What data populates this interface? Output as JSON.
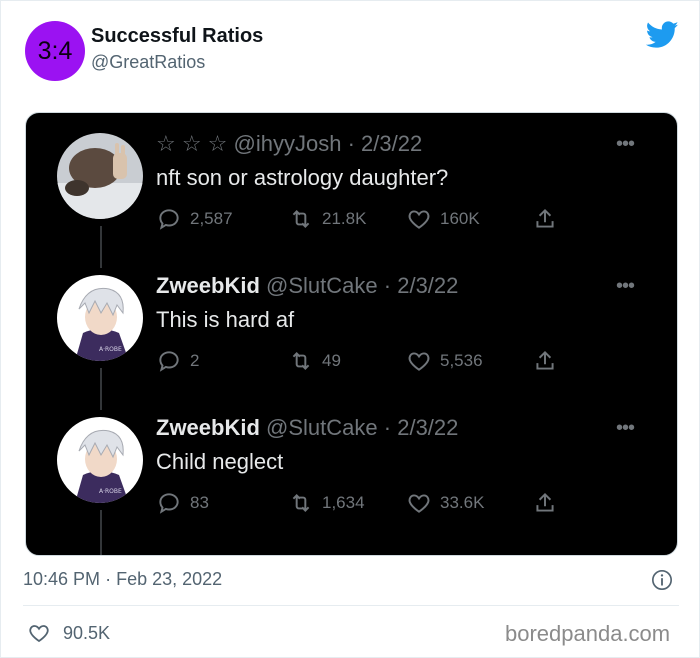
{
  "header": {
    "avatar_text": "3:4",
    "avatar_color": "#9b12f2",
    "name": "Successful Ratios",
    "handle": "@GreatRatios",
    "logo_icon": "twitter-bird-icon",
    "brand_color": "#1d9bf0"
  },
  "embedded_thread": {
    "tweets": [
      {
        "name": "",
        "stars": "☆ ☆ ☆",
        "handle": "@ihyyJosh",
        "date": "2/3/22",
        "text": "nft son or astrology daughter?",
        "replies": "2,587",
        "retweets": "21.8K",
        "likes": "160K"
      },
      {
        "name": "ZweebKid",
        "handle": "@SlutCake",
        "date": "2/3/22",
        "text": "This is hard af",
        "replies": "2",
        "retweets": "49",
        "likes": "5,536"
      },
      {
        "name": "ZweebKid",
        "handle": "@SlutCake",
        "date": "2/3/22",
        "text": "Child neglect",
        "replies": "83",
        "retweets": "1,634",
        "likes": "33.6K"
      }
    ],
    "more_glyph": "•••",
    "separator": "·"
  },
  "footer": {
    "time": "10:46 PM",
    "separator": "·",
    "date": "Feb 23, 2022",
    "likes": "90.5K"
  },
  "watermark": "boredpanda.com"
}
